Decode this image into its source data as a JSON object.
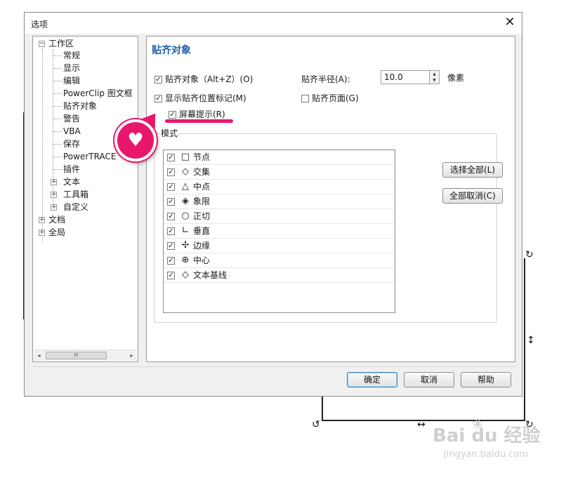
{
  "dialog": {
    "title": "选项",
    "close_glyph": "✕"
  },
  "tree": {
    "nodes": [
      {
        "label": "工作区",
        "expander": "−"
      },
      {
        "label": "常规"
      },
      {
        "label": "显示"
      },
      {
        "label": "编辑"
      },
      {
        "label": "PowerClip 图文框"
      },
      {
        "label": "贴齐对象"
      },
      {
        "label": "警告"
      },
      {
        "label": "VBA"
      },
      {
        "label": "保存"
      },
      {
        "label": "PowerTRACE"
      },
      {
        "label": "插件"
      },
      {
        "label": "文本",
        "expander": "+"
      },
      {
        "label": "工具箱",
        "expander": "+"
      },
      {
        "label": "自定义",
        "expander": "+"
      },
      {
        "label": "文档",
        "expander": "+"
      },
      {
        "label": "全局",
        "expander": "+"
      }
    ],
    "scroll_left": "◂",
    "scroll_right": "▸",
    "scroll_thumb": "III"
  },
  "panel": {
    "section_title": "贴齐对象",
    "snap_objects": {
      "label": "贴齐对象（Alt+Z）(O)",
      "checked": true
    },
    "show_marker": {
      "label": "显示贴齐位置标记(M)",
      "checked": true
    },
    "screen_tip": {
      "label": "屏幕提示(R)",
      "checked": true
    },
    "snap_radius_label": "贴齐半径(A):",
    "snap_radius_value": "10.0",
    "snap_radius_unit": "像素",
    "snap_page": {
      "label": "贴齐页面(G)",
      "checked": false
    },
    "spin_up": "▲",
    "spin_down": "▼",
    "check_glyph": "✓",
    "modes_label": "模式",
    "modes": [
      {
        "icon": "□",
        "label": "节点",
        "checked": true
      },
      {
        "icon": "◇",
        "label": "交集",
        "checked": true
      },
      {
        "icon": "△",
        "label": "中点",
        "checked": true
      },
      {
        "icon": "◈",
        "label": "象限",
        "checked": true
      },
      {
        "icon": "○",
        "label": "正切",
        "checked": true
      },
      {
        "icon": "∟",
        "label": "垂直",
        "checked": true
      },
      {
        "icon": "✢",
        "label": "边缘",
        "checked": true
      },
      {
        "icon": "⊕",
        "label": "中心",
        "checked": true
      },
      {
        "icon": "◇",
        "label": "文本基线",
        "checked": true
      }
    ],
    "select_all": "选择全部(L)",
    "deselect_all": "全部取消(C)"
  },
  "footer": {
    "ok": "确定",
    "cancel": "取消",
    "help": "帮助"
  },
  "annotation": {
    "heart_glyph": "♥",
    "accent": "#e8176c"
  },
  "watermark": {
    "brand": "Bai du 经验",
    "url": "jingyan.baidu.com"
  },
  "colors": {
    "section_title": "#1f5fa8",
    "default_button_border": "#3c7fb1"
  }
}
